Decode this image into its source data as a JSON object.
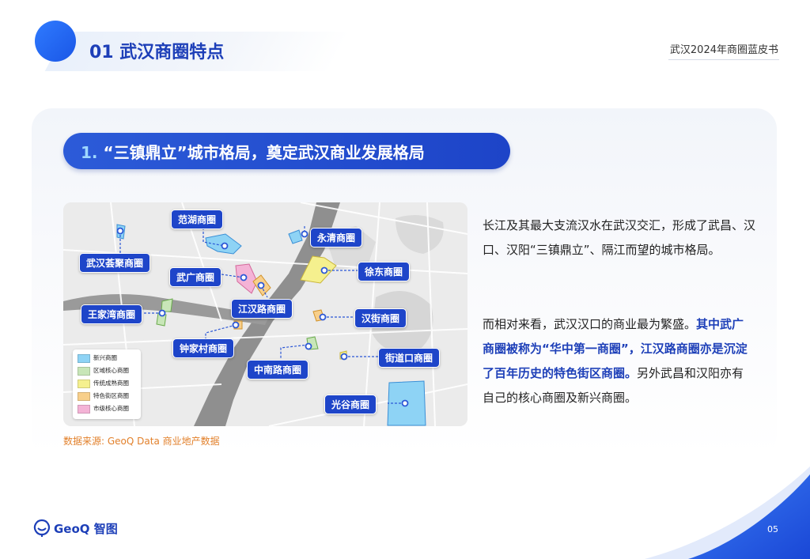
{
  "header": {
    "title": "01 武汉商圈特点",
    "report_name": "武汉2024年商圈蓝皮书"
  },
  "section": {
    "number": "1.",
    "title": "“三镇鼎立”城市格局，奠定武汉商业发展格局"
  },
  "map": {
    "labels": {
      "fanhu": "范湖商圈",
      "yongqing": "永清商圈",
      "huijv": "武汉荟聚商圈",
      "xudong": "徐东商圈",
      "wuguang": "武广商圈",
      "jianghanlu": "江汉路商圈",
      "wangjiawan": "王家湾商圈",
      "hanjie": "汉街商圈",
      "zhongjiacun": "钟家村商圈",
      "jiedaokou": "街道口商圈",
      "zhongnanlu": "中南路商圈",
      "guanggu": "光谷商圈"
    },
    "legend": [
      {
        "label": "新兴商圈",
        "color": "#8ed3f5"
      },
      {
        "label": "区域核心商圈",
        "color": "#c8e6b8"
      },
      {
        "label": "传统成熟商圈",
        "color": "#f5f08e"
      },
      {
        "label": "特色街区商圈",
        "color": "#f8cf8a"
      },
      {
        "label": "市级核心商圈",
        "color": "#f4b3d6"
      }
    ],
    "source": "数据来源: GeoQ Data 商业地产数据"
  },
  "text": {
    "para1": "长江及其最大支流汉水在武汉交汇，形成了武昌、汉口、汉阳“三镇鼎立”、隔江而望的城市格局。",
    "para2_normal1": "而相对来看，武汉汉口的商业最为繁盛。",
    "para2_highlight": "其中武广商圈被称为“华中第一商圈”，江汉路商圈亦是沉淀了百年历史的特色街区商圈。",
    "para2_normal2": "另外武昌和汉阳亦有自己的核心商圈及新兴商圈。"
  },
  "footer": {
    "logo_text": "GeoQ 智图",
    "page_number": "05"
  },
  "colors": {
    "brand_blue": "#1d3fb8",
    "accent_blue": "#2f7bff",
    "source_orange": "#e2802b"
  }
}
